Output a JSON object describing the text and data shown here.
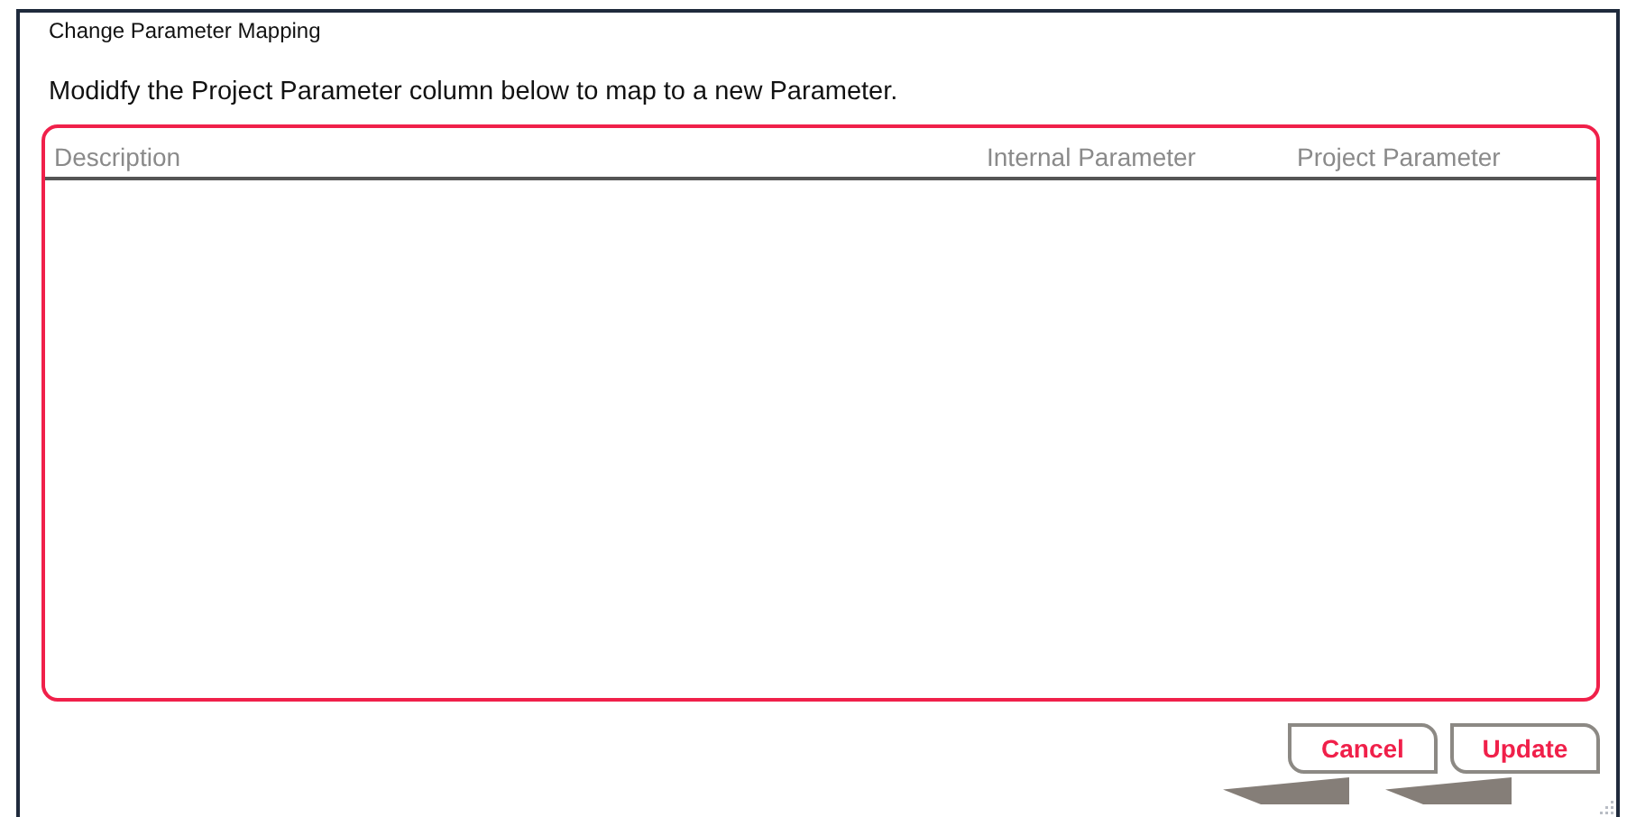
{
  "window": {
    "title": "Change Parameter Mapping"
  },
  "instruction": "Modidfy the Project Parameter column below to map to a new Parameter.",
  "table": {
    "columns": [
      "Description",
      "Internal Parameter",
      "Project Parameter"
    ]
  },
  "buttons": [
    {
      "label": "Cancel"
    },
    {
      "label": "Update"
    }
  ]
}
